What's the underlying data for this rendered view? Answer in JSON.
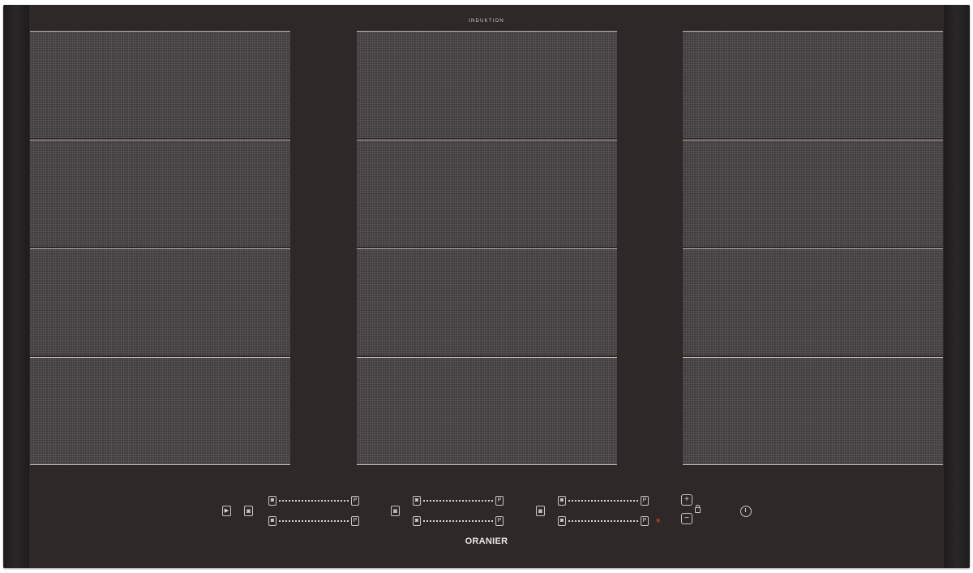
{
  "top_label": "INDUKTION",
  "brand": "ORANIER",
  "controls": {
    "play_symbol": "▶",
    "zone_key_symbol": "◙",
    "slider_minus_symbol": "◙",
    "slider_plus_symbol": "P",
    "plus_symbol": "+",
    "minus_symbol": "−",
    "indicator_symbol": "∗"
  },
  "zones": {
    "left": [
      "zone-1",
      "zone-2",
      "zone-3",
      "zone-4"
    ],
    "center": [
      "zone-5",
      "zone-6",
      "zone-7",
      "zone-8"
    ],
    "right": [
      "zone-9",
      "zone-10",
      "zone-11",
      "zone-12"
    ]
  },
  "colors": {
    "panel": "#2e2828",
    "zone": "#4a4546",
    "zone_border": "#bdb7b6",
    "indicator": "#d63d2a"
  }
}
